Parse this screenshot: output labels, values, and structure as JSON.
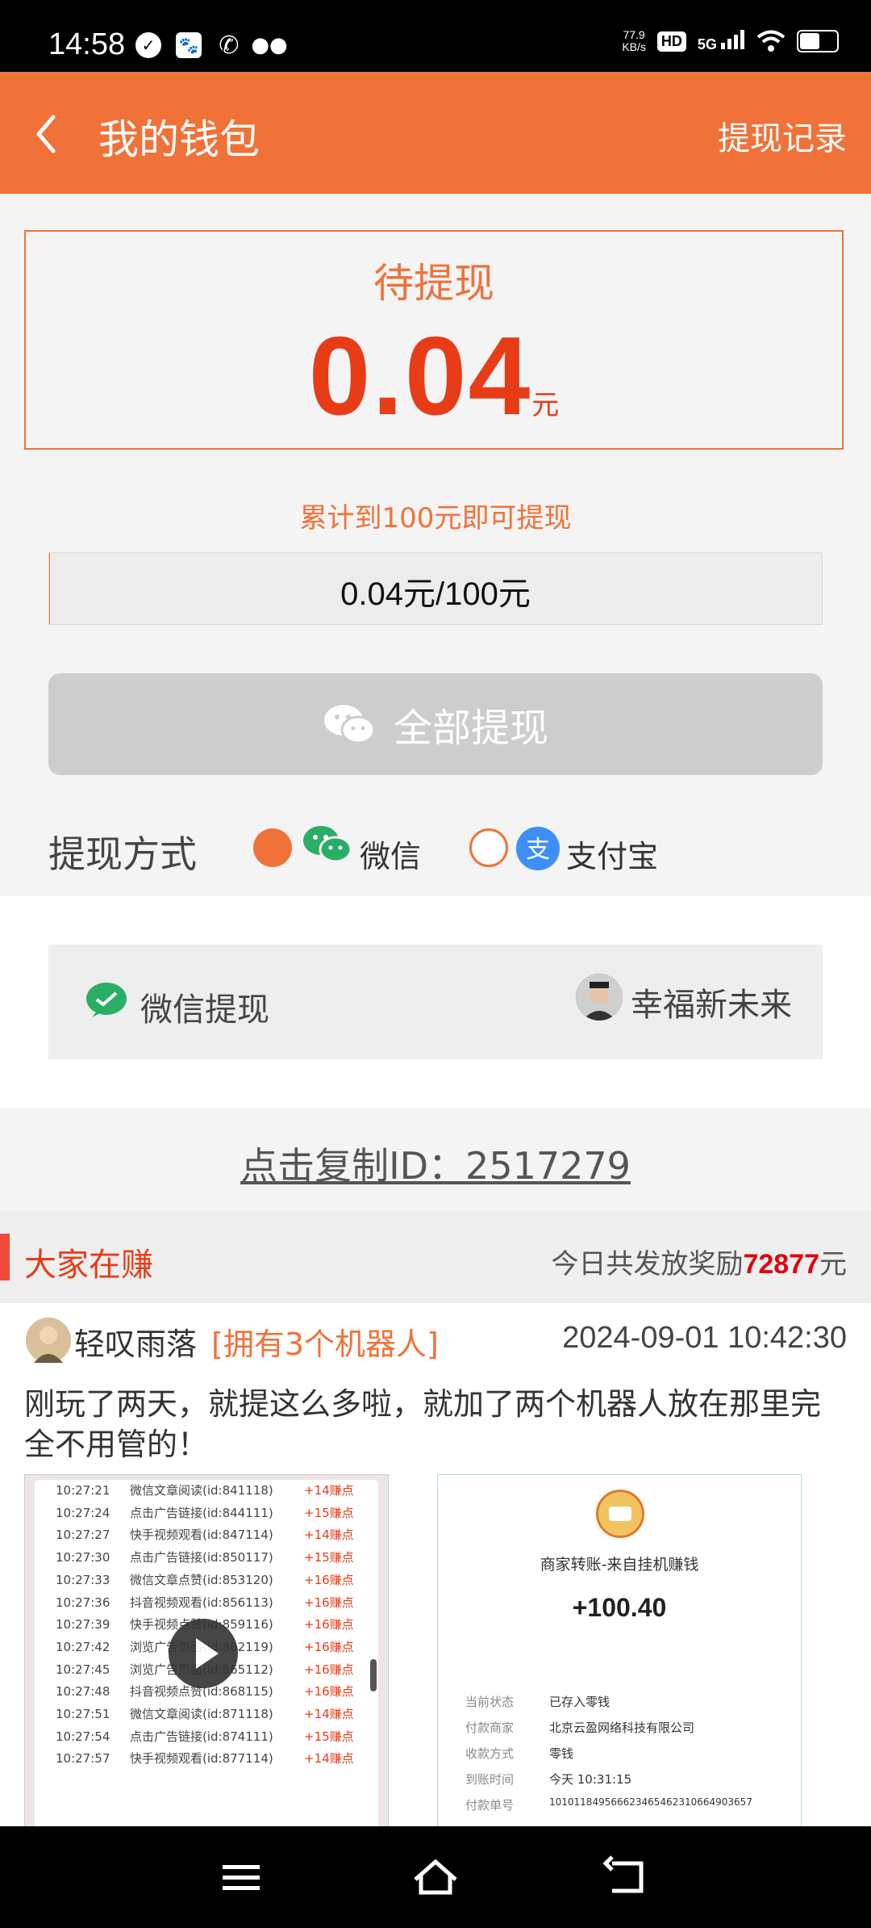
{
  "status_bar": {
    "time": "14:58",
    "speed_value": "77.9",
    "speed_unit": "KB/s",
    "hd": "HD",
    "network": "5G",
    "battery_level": 0.55,
    "icons": [
      "check-icon",
      "paw-icon",
      "call-icon",
      "wechat-icon",
      "wifi-icon",
      "signal-icon",
      "battery-icon"
    ]
  },
  "header": {
    "title": "我的钱包",
    "right_link": "提现记录"
  },
  "balance": {
    "label": "待提现",
    "amount": "0.04",
    "unit": "元"
  },
  "threshold_text": "累计到100元即可提现",
  "progress": {
    "text": "0.04元/100元",
    "fraction": 0.0004
  },
  "withdraw_button": "全部提现",
  "methods": {
    "label": "提现方式",
    "options": [
      {
        "label": "微信",
        "selected": true
      },
      {
        "label": "支付宝",
        "selected": false
      }
    ]
  },
  "account": {
    "label": "微信提现",
    "name": "幸福新未来"
  },
  "copy_id": "点击复制ID：2517279",
  "earn": {
    "title": "大家在赚",
    "stat_prefix": "今日共发放奖励",
    "stat_value": "72877",
    "stat_suffix": "元"
  },
  "feed": {
    "user": "轻叹雨落",
    "badge": "[拥有3个机器人]",
    "time": "2024-09-01 10:42:30",
    "text": "刚玩了两天，就提这么多啦，就加了两个机器人放在那里完全不用管的！",
    "log_rows": [
      {
        "time": "10:27:21",
        "action": "微信文章阅读(id:841118)",
        "points": "+14赚点"
      },
      {
        "time": "10:27:24",
        "action": "点击广告链接(id:844111)",
        "points": "+15赚点"
      },
      {
        "time": "10:27:27",
        "action": "快手视频观看(id:847114)",
        "points": "+14赚点"
      },
      {
        "time": "10:27:30",
        "action": "点击广告链接(id:850117)",
        "points": "+15赚点"
      },
      {
        "time": "10:27:33",
        "action": "微信文章点赞(id:853120)",
        "points": "+16赚点"
      },
      {
        "time": "10:27:36",
        "action": "抖音视频观看(id:856113)",
        "points": "+16赚点"
      },
      {
        "time": "10:27:39",
        "action": "快手视频点赞(id:859116)",
        "points": "+16赚点"
      },
      {
        "time": "10:27:42",
        "action": "浏览广告页面(id:862119)",
        "points": "+16赚点"
      },
      {
        "time": "10:27:45",
        "action": "浏览广告页面(id:865112)",
        "points": "+16赚点"
      },
      {
        "time": "10:27:48",
        "action": "抖音视频点赞(id:868115)",
        "points": "+16赚点"
      },
      {
        "time": "10:27:51",
        "action": "微信文章阅读(id:871118)",
        "points": "+14赚点"
      },
      {
        "time": "10:27:54",
        "action": "点击广告链接(id:874111)",
        "points": "+15赚点"
      },
      {
        "time": "10:27:57",
        "action": "快手视频观看(id:877114)",
        "points": "+14赚点"
      }
    ],
    "receipt": {
      "title": "商家转账-来自挂机赚钱",
      "amount": "+100.40",
      "rows": [
        {
          "key": "当前状态",
          "value": "已存入零钱"
        },
        {
          "key": "付款商家",
          "value": "北京云盈网络科技有限公司"
        },
        {
          "key": "收款方式",
          "value": "零钱"
        },
        {
          "key": "到账时间",
          "value": "今天 10:31:15"
        },
        {
          "key": "付款单号",
          "value": "10101184956662346546231066490365​7"
        }
      ]
    }
  },
  "nav": [
    "menu-icon",
    "home-icon",
    "back-icon"
  ]
}
